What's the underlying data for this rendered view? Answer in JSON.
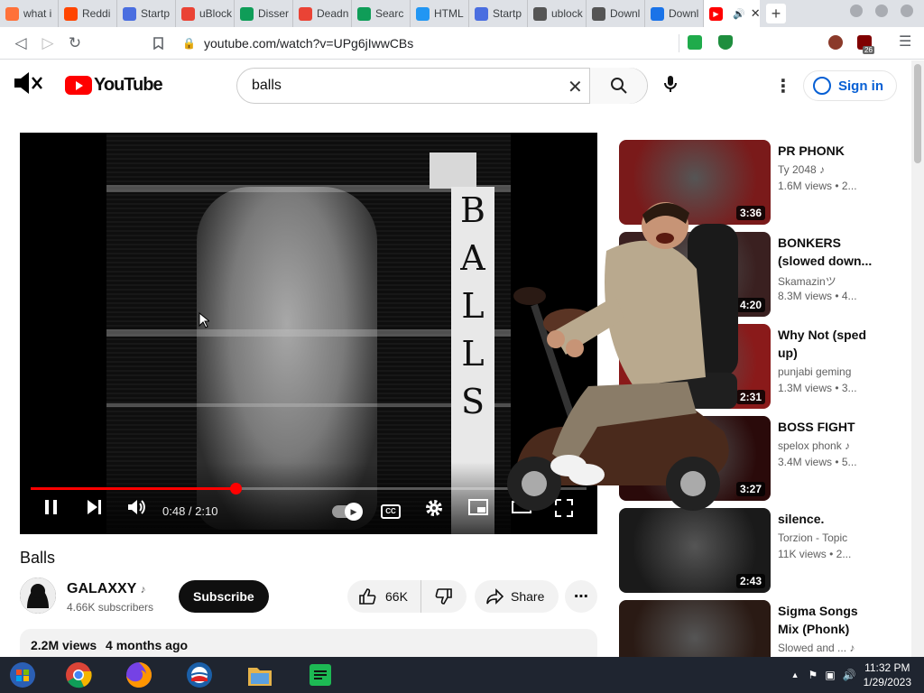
{
  "browser": {
    "tabs": [
      {
        "label": "what i",
        "color": "#ff7139"
      },
      {
        "label": "Reddi",
        "color": "#ff4500"
      },
      {
        "label": "Startp",
        "color": "#4a6ee0"
      },
      {
        "label": "uBlock",
        "color": "#ea4335"
      },
      {
        "label": "Disser",
        "color": "#0f9d58"
      },
      {
        "label": "Deadn",
        "color": "#ea4335"
      },
      {
        "label": "Searc",
        "color": "#0f9d58"
      },
      {
        "label": "HTML",
        "color": "#2196f3"
      },
      {
        "label": "Startp",
        "color": "#4a6ee0"
      },
      {
        "label": "ublock",
        "color": "#555555"
      },
      {
        "label": "Downl",
        "color": "#555555"
      },
      {
        "label": "Downl",
        "color": "#1a73e8"
      }
    ],
    "active_tab": {
      "icon": "youtube-icon",
      "audio": "🔊",
      "close": "✕"
    },
    "url": "youtube.com/watch?v=UPg6jIwwCBs",
    "extension_badge": "26"
  },
  "youtube": {
    "logo": "YouTube",
    "search_value": "balls",
    "sign_in": "Sign in",
    "colors": {
      "red": "#ff0000",
      "link_blue": "#065fd4"
    }
  },
  "player": {
    "overlay_text": [
      "B",
      "A",
      "L",
      "L",
      "S"
    ],
    "time": "0:48 / 2:10",
    "progress_fraction": 0.369,
    "cc_label": "CC"
  },
  "video": {
    "title": "Balls",
    "channel": "GALAXXY",
    "channel_icon": "music-note-icon",
    "subscribers": "4.66K subscribers",
    "subscribe_label": "Subscribe",
    "likes": "66K",
    "share_label": "Share",
    "views": "2.2M views",
    "age": "4 months ago"
  },
  "recommendations": [
    {
      "title_lines": [
        "PR PHONK"
      ],
      "channel": "Ty 2048",
      "note": true,
      "stats": "1.6M views  •  2...",
      "duration": "3:36",
      "thumb": "#7a1a1a"
    },
    {
      "title_lines": [
        "BONKERS",
        "(slowed down..."
      ],
      "channel": "Skamazinツ",
      "note": false,
      "stats": "8.3M views  •  4...",
      "duration": "4:20",
      "thumb": "#3a2020"
    },
    {
      "title_lines": [
        "Why Not (sped",
        "up)"
      ],
      "channel": "punjabi geming",
      "note": false,
      "stats": "1.3M views  •  3...",
      "duration": "2:31",
      "thumb": "#8a1a1a"
    },
    {
      "title_lines": [
        "BOSS FIGHT"
      ],
      "channel": "spelox phonk",
      "note": true,
      "stats": "3.4M views  •  5...",
      "duration": "3:27",
      "thumb": "#2a0a0a"
    },
    {
      "title_lines": [
        "silence."
      ],
      "channel": "Torzion - Topic",
      "note": false,
      "stats": "11K views  •  2...",
      "duration": "2:43",
      "thumb": "#1a1a1a"
    },
    {
      "title_lines": [
        "Sigma Songs",
        "Mix (Phonk)"
      ],
      "channel": "Slowed and ...",
      "note": true,
      "stats": "",
      "duration": "",
      "thumb": "#2a1a14"
    }
  ],
  "taskbar": {
    "apps": [
      "windows-start-icon",
      "chrome-icon",
      "firefox-icon",
      "obama-campaign-icon",
      "file-explorer-icon",
      "spotify-like-icon"
    ],
    "time": "11:32 PM",
    "date": "1/29/2023"
  }
}
